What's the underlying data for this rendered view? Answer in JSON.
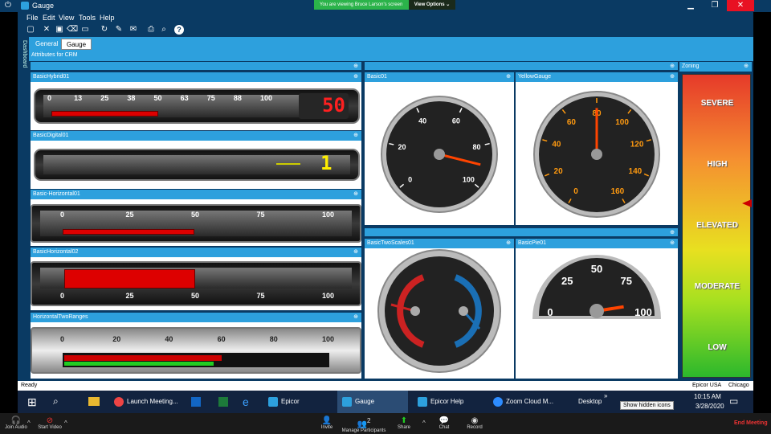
{
  "window": {
    "title": "Gauge",
    "min": "▁",
    "max": "❐",
    "close": "✕"
  },
  "zoom_banner": {
    "text": "You are viewing Bruce Larson's screen",
    "options": "View Options ⌄"
  },
  "menu": [
    "File",
    "Edit",
    "View",
    "Tools",
    "Help"
  ],
  "rail_label": "Dashboard",
  "tabs": [
    {
      "label": "General"
    },
    {
      "label": "Gauge"
    }
  ],
  "attr_label": "Attributes for CRM",
  "panels": {
    "hybrid": {
      "title": "BasicHybrid01",
      "ticks": [
        "0",
        "13",
        "25",
        "38",
        "50",
        "63",
        "75",
        "88",
        "100"
      ],
      "readout": "50",
      "value_pct": 50
    },
    "digital": {
      "title": "BasicDigital01",
      "readout": "1"
    },
    "horiz1": {
      "title": "Basic-Horizontal01",
      "ticks": [
        "0",
        "25",
        "50",
        "75",
        "100"
      ],
      "value_pct": 50
    },
    "horiz2": {
      "title": "BasicHorizontal02",
      "ticks": [
        "0",
        "25",
        "50",
        "75",
        "100"
      ],
      "value_pct": 50
    },
    "tworanges": {
      "title": "HorizontalTwoRanges",
      "ticks": [
        "0",
        "20",
        "40",
        "60",
        "80",
        "100"
      ],
      "red_pct": 60,
      "green_pct": 57
    },
    "basic01": {
      "title": "Basic01",
      "ticks": [
        "0",
        "20",
        "40",
        "60",
        "80",
        "100"
      ],
      "value_pct": 90
    },
    "yellow": {
      "title": "YellowGauge",
      "ticks": [
        "0",
        "20",
        "40",
        "60",
        "80",
        "100",
        "120",
        "140",
        "160"
      ],
      "value_pct": 50
    },
    "twoscales": {
      "title": "BasicTwoScales01"
    },
    "pie": {
      "title": "BasicPie01",
      "ticks": [
        "0",
        "25",
        "50",
        "75",
        "100"
      ],
      "value_pct": 95
    },
    "zoning": {
      "title": "Zoning",
      "levels": [
        "SEVERE",
        "HIGH",
        "ELEVATED",
        "MODERATE",
        "LOW"
      ]
    }
  },
  "status": {
    "left": "Ready",
    "right1": "Epicor USA",
    "right2": "Chicago"
  },
  "taskbar": {
    "items": [
      "Launch Meeting...",
      "Epicor",
      "Gauge",
      "Epicor Help",
      "Zoom Cloud M..."
    ],
    "desktop": "Desktop",
    "tooltip": "Show hidden icons",
    "time": "10:15 AM",
    "date": "3/28/2020"
  },
  "zoom_controls": {
    "join_audio": "Join Audio",
    "start_video": "Start Video",
    "invite": "Invite",
    "participants": "Manage Participants",
    "participants_count": "2",
    "share": "Share",
    "chat": "Chat",
    "record": "Record",
    "end": "End Meeting"
  },
  "colors": {
    "accent": "#2da0dd",
    "dark": "#0a3a63",
    "needle": "#ff4400",
    "bar_red": "#dd0000"
  }
}
